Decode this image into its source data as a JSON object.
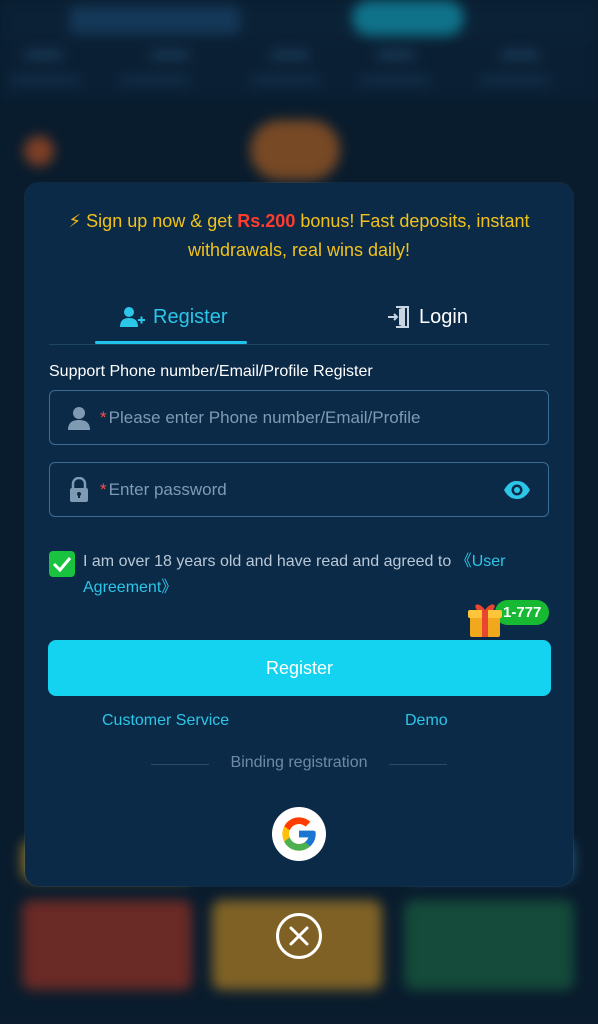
{
  "promo": {
    "icon": "lightning-icon",
    "text_before": "Sign up now & get ",
    "amount": "Rs.200",
    "text_after": " bonus! Fast deposits, instant withdrawals, real wins daily!"
  },
  "tabs": {
    "register": {
      "label": "Register",
      "icon": "add-user-icon"
    },
    "login": {
      "label": "Login",
      "icon": "login-door-icon"
    }
  },
  "form": {
    "support_label": "Support Phone number/Email/Profile Register",
    "required_mark": "*",
    "account_placeholder": "Please enter Phone number/Email/Profile",
    "password_placeholder": "Enter password",
    "agree_text": "I am over 18 years old and have read and agreed to ",
    "agree_link": "《User Agreement》",
    "agree_checked": true
  },
  "badge": {
    "label": "1-777",
    "icon": "gift-icon"
  },
  "register_button": "Register",
  "links": {
    "customer_service": "Customer Service",
    "demo": "Demo"
  },
  "binding_label": "Binding registration",
  "colors": {
    "accent": "#14d3f0",
    "modal_bg": "#0b2a47",
    "promo_text": "#f2c21b",
    "promo_amount": "#ff3c2f",
    "check_green": "#19c23f"
  }
}
